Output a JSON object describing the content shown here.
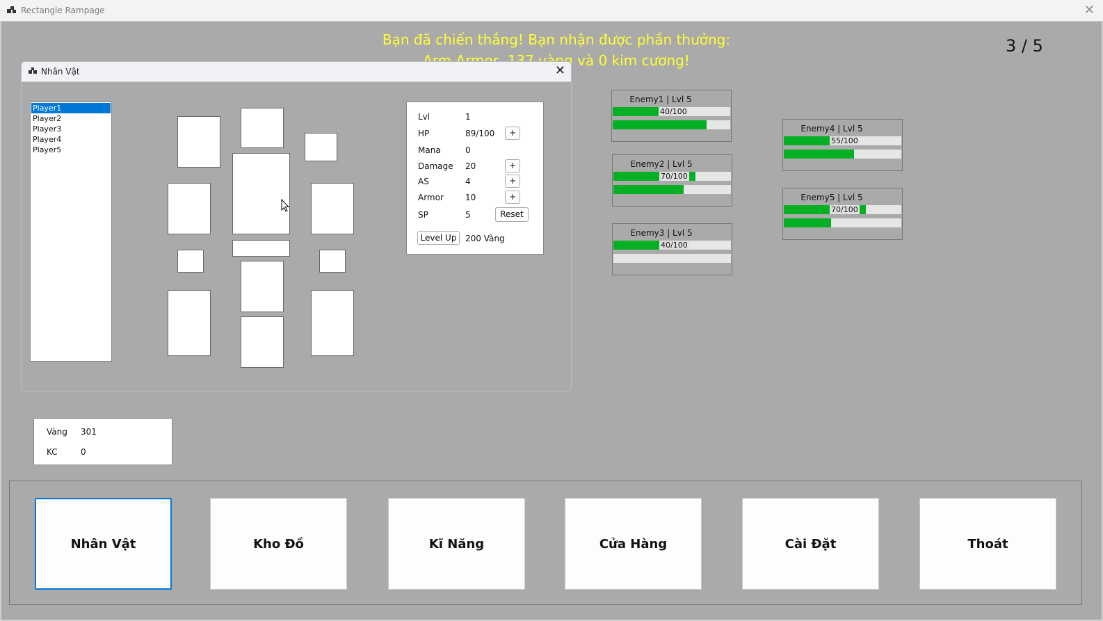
{
  "window": {
    "title": "Rectangle Rampage"
  },
  "message": {
    "line1": "Bạn đã chiến thắng! Bạn nhận được phần thưởng:",
    "line2": "Arm Armor, 137 vàng và 0 kim cương!"
  },
  "round": "3 / 5",
  "character_window": {
    "title": "Nhân Vật",
    "players": [
      "Player1",
      "Player2",
      "Player3",
      "Player4",
      "Player5"
    ],
    "selected_player": "Player1",
    "stats": {
      "lvl_label": "Lvl",
      "lvl": "1",
      "hp_label": "HP",
      "hp": "89/100",
      "mana_label": "Mana",
      "mana": "0",
      "damage_label": "Damage",
      "damage": "20",
      "as_label": "AS",
      "as": "4",
      "armor_label": "Armor",
      "armor": "10",
      "sp_label": "SP",
      "sp": "5",
      "plus": "+",
      "reset": "Reset",
      "level_up": "Level Up",
      "level_up_cost": "200 Vàng"
    }
  },
  "wallet": {
    "gold_label": "Vàng",
    "gold": "301",
    "kc_label": "KC",
    "kc": "0"
  },
  "enemies": [
    {
      "name": "Enemy1 | Lvl 5",
      "hp_text": "40/100",
      "hp": 0.4,
      "mana": 0.8
    },
    {
      "name": "Enemy2 | Lvl 5",
      "hp_text": "70/100",
      "hp": 0.7,
      "mana": 0.6
    },
    {
      "name": "Enemy3 | Lvl 5",
      "hp_text": "40/100",
      "hp": 0.4,
      "mana": 0.0
    },
    {
      "name": "Enemy4 | Lvl 5",
      "hp_text": "55/100",
      "hp": 0.55,
      "mana": 0.6
    },
    {
      "name": "Enemy5 | Lvl 5",
      "hp_text": "70/100",
      "hp": 0.7,
      "mana": 0.4
    }
  ],
  "menu": {
    "nhan_vat": "Nhân Vật",
    "kho_do": "Kho Đồ",
    "ki_nang": "Kĩ Năng",
    "cua_hang": "Cửa Hàng",
    "cai_dat": "Cài Đặt",
    "thoat": "Thoát"
  },
  "colors": {
    "message": "#ffff33",
    "bar_fill": "#06b025",
    "selection": "#0078d7"
  }
}
